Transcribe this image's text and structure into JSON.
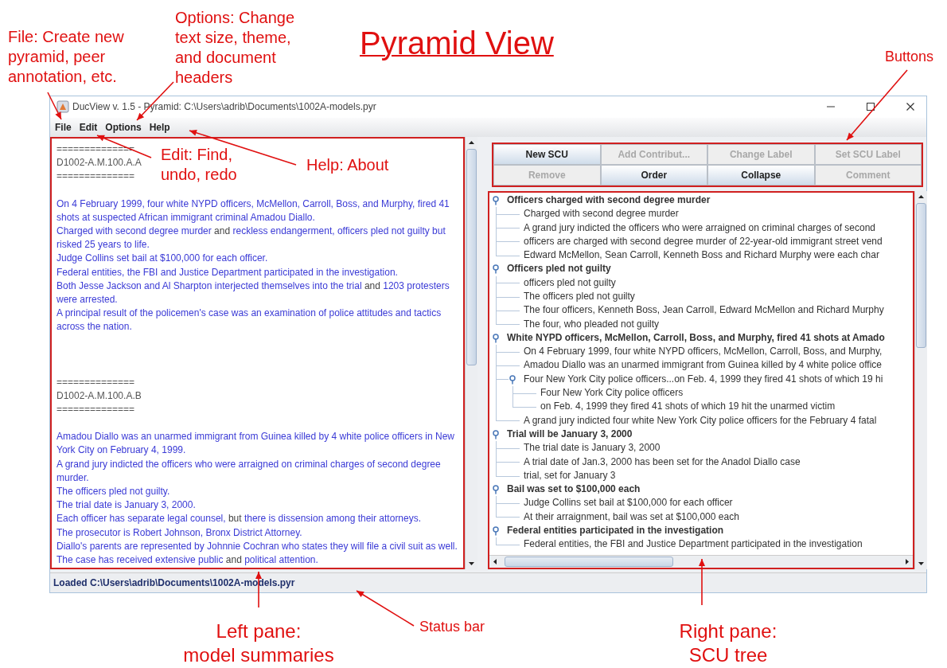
{
  "annotations": {
    "title": "Pyramid View",
    "notes": [
      {
        "lines": [
          "File: Create new",
          "pyramid, peer",
          "annotation, etc."
        ]
      },
      {
        "lines": [
          "Options: Change",
          "text size, theme,",
          "and document",
          "headers"
        ]
      },
      {
        "lines": [
          "Buttons"
        ]
      },
      {
        "lines": [
          "Edit: Find,",
          "undo, redo"
        ]
      },
      {
        "lines": [
          "Help: About"
        ]
      },
      {
        "lines": [
          "Left pane:",
          "model summaries"
        ]
      },
      {
        "lines": [
          "Status bar"
        ]
      },
      {
        "lines": [
          "Right pane:",
          "SCU tree"
        ]
      }
    ]
  },
  "window": {
    "title": "DucView v. 1.5 - Pyramid: C:\\Users\\adrib\\Documents\\1002A-models.pyr"
  },
  "menu": [
    {
      "label": "File"
    },
    {
      "label": "Edit"
    },
    {
      "label": "Options"
    },
    {
      "label": "Help"
    }
  ],
  "left_pane": {
    "documents": [
      {
        "rule_above": "==============",
        "id": "D1002-A.M.100.A.A",
        "rule_below": "==============",
        "sentences": [
          [
            {
              "text": "On 4 February 1999, four white NYPD officers, McMellon, Carroll, Boss, and Murphy, fired 41 shots at suspected African immigrant criminal Amadou Diallo.",
              "highlighted": true
            }
          ],
          [
            {
              "text": "Charged with second degree murder",
              "highlighted": true
            },
            {
              "text": " and ",
              "highlighted": false
            },
            {
              "text": "reckless endangerment, officers pled not guilty but risked 25 years to life.",
              "highlighted": true
            }
          ],
          [
            {
              "text": "Judge Collins set bail at $100,000 for each officer.",
              "highlighted": true
            }
          ],
          [
            {
              "text": "Federal entities, the FBI and Justice Department participated in the investigation.",
              "highlighted": true
            }
          ],
          [
            {
              "text": "Both Jesse Jackson and Al Sharpton interjected themselves into the trial",
              "highlighted": true
            },
            {
              "text": " and ",
              "highlighted": false
            },
            {
              "text": "1203 protesters were arrested.",
              "highlighted": true
            }
          ],
          [
            {
              "text": "A principal result of the policemen's case was an examination of police attitudes and tactics across the nation.",
              "highlighted": true
            }
          ]
        ]
      },
      {
        "rule_above": "==============",
        "id": "D1002-A.M.100.A.B",
        "rule_below": "==============",
        "sentences": [
          [
            {
              "text": "Amadou Diallo was an unarmed immigrant from Guinea killed by 4 white police officers in New York City on February 4, 1999.",
              "highlighted": true
            }
          ],
          [
            {
              "text": "A grand jury indicted the officers who were arraigned on criminal charges of second degree murder.",
              "highlighted": true
            }
          ],
          [
            {
              "text": "The officers pled not guilty.",
              "highlighted": true
            }
          ],
          [
            {
              "text": "The trial date is January 3, 2000.",
              "highlighted": true
            }
          ],
          [
            {
              "text": "Each officer has separate legal counsel,",
              "highlighted": true
            },
            {
              "text": " but ",
              "highlighted": false
            },
            {
              "text": "there is dissension among their attorneys.",
              "highlighted": true
            }
          ],
          [
            {
              "text": "The prosecutor is Robert Johnson, Bronx District Attorney.",
              "highlighted": true
            }
          ],
          [
            {
              "text": "Diallo's parents are represented by Johnnie Cochran who states they will file a civil suit as well.",
              "highlighted": true
            }
          ],
          [
            {
              "text": "The case has received extensive public",
              "highlighted": true
            },
            {
              "text": " and ",
              "highlighted": false
            },
            {
              "text": "political attention.",
              "highlighted": true
            }
          ]
        ]
      }
    ]
  },
  "buttons": [
    {
      "label": "New SCU",
      "disabled": false
    },
    {
      "label": "Add Contribut...",
      "disabled": true
    },
    {
      "label": "Change Label",
      "disabled": true
    },
    {
      "label": "Set SCU Label",
      "disabled": true
    },
    {
      "label": "Remove",
      "disabled": true
    },
    {
      "label": "Order",
      "disabled": false
    },
    {
      "label": "Collapse",
      "disabled": false
    },
    {
      "label": "Comment",
      "disabled": true
    }
  ],
  "tree": [
    {
      "label": "Officers charged with second degree murder",
      "expanded": true,
      "children": [
        {
          "label": "Charged with second degree murder"
        },
        {
          "label": "A grand jury indicted the officers who were arraigned on criminal charges of second"
        },
        {
          "label": "officers are charged with second degree murder of 22-year-old immigrant street vend"
        },
        {
          "label": "Edward McMellon, Sean Carroll, Kenneth Boss and Richard Murphy were each char"
        }
      ]
    },
    {
      "label": "Officers pled not guilty",
      "expanded": true,
      "children": [
        {
          "label": "officers pled not guilty"
        },
        {
          "label": "The officers pled not guilty"
        },
        {
          "label": "The four officers, Kenneth Boss, Jean Carroll, Edward McMellon and Richard Murphy"
        },
        {
          "label": "The four, who pleaded not guilty"
        }
      ]
    },
    {
      "label": "White NYPD officers, McMellon, Carroll, Boss, and Murphy, fired 41 shots at Amado",
      "expanded": true,
      "children": [
        {
          "label": "On 4 February 1999, four white NYPD officers, McMellon, Carroll, Boss, and Murphy,"
        },
        {
          "label": "Amadou Diallo was an unarmed immigrant from Guinea killed by 4 white police office"
        },
        {
          "label": "Four New York City police officers...on Feb. 4, 1999 they fired 41 shots of which 19 hi",
          "expanded": true,
          "children": [
            {
              "label": "Four New York City police officers"
            },
            {
              "label": "on Feb. 4, 1999 they fired 41 shots of which 19 hit the unarmed victim"
            }
          ]
        },
        {
          "label": "A grand jury indicted four white New York City police officers for the February 4 fatal"
        }
      ]
    },
    {
      "label": "Trial will be January 3, 2000",
      "expanded": true,
      "children": [
        {
          "label": "The trial date is January 3, 2000"
        },
        {
          "label": "A trial date of Jan.3, 2000 has been set for the Anadol Diallo case"
        },
        {
          "label": "trial, set for January 3"
        }
      ]
    },
    {
      "label": "Bail was set to $100,000 each",
      "expanded": true,
      "children": [
        {
          "label": "Judge Collins set bail at $100,000 for each officer"
        },
        {
          "label": "At their arraignment, bail was set at $100,000 each"
        }
      ]
    },
    {
      "label": "Federal entities participated in the investigation",
      "expanded": true,
      "children": [
        {
          "label": "Federal entities, the FBI and Justice Department participated in the investigation"
        }
      ]
    }
  ],
  "status_bar": {
    "text": "Loaded C:\\Users\\adrib\\Documents\\1002A-models.pyr"
  }
}
